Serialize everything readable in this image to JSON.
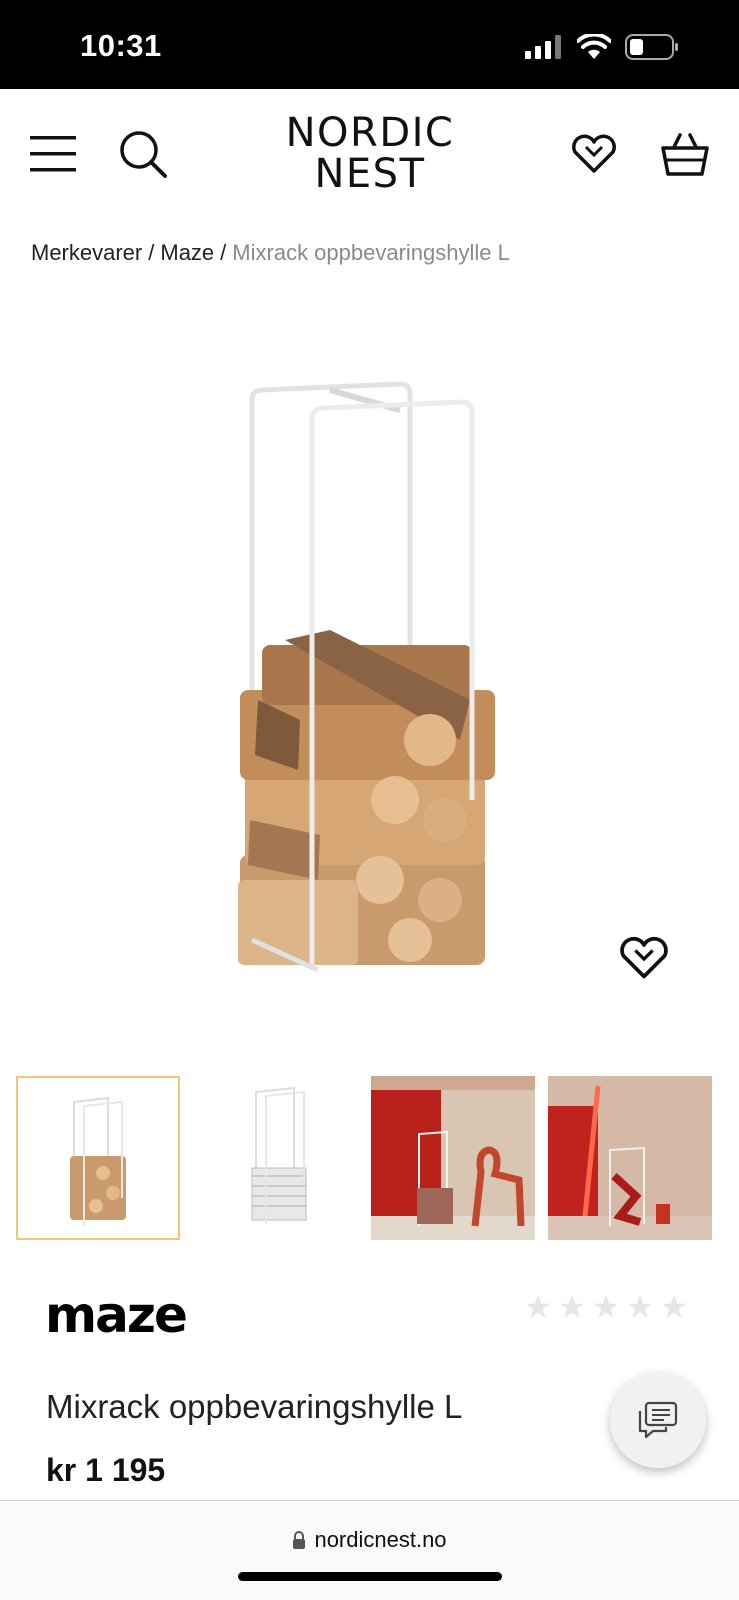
{
  "status_bar": {
    "time": "10:31",
    "icons": [
      "signal-icon",
      "wifi-icon",
      "battery-icon"
    ]
  },
  "header": {
    "logo_line1": "NORDIC",
    "logo_line2": "NEST",
    "icons": [
      "menu-icon",
      "search-icon",
      "heart-icon",
      "basket-icon"
    ]
  },
  "breadcrumb": {
    "items": [
      "Merkevarer",
      "Maze"
    ],
    "separator": "/",
    "current": "Mixrack oppbevaringshylle L"
  },
  "gallery": {
    "thumbnails": [
      "Firewood rack",
      "Magazine rack",
      "Red room scene",
      "Neon room scene"
    ],
    "active_index": 0,
    "active_border_color": "#f0c77a"
  },
  "product": {
    "brand": "maze",
    "title": "Mixrack oppbevaringshylle L",
    "price": "kr 1 195",
    "rating": 0,
    "rating_max": 5
  },
  "browser": {
    "url": "nordicnest.no"
  }
}
